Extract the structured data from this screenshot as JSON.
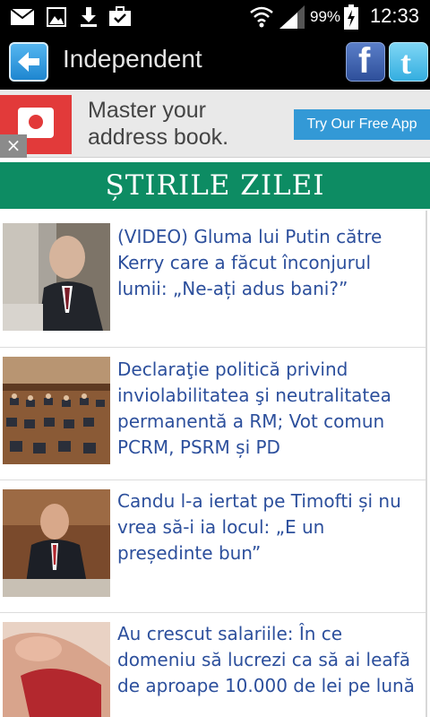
{
  "status_bar": {
    "battery": "99%",
    "time": "12:33",
    "icons": [
      "mail-icon",
      "image-icon",
      "download-icon",
      "briefcase-icon",
      "wifi-icon",
      "signal-icon",
      "battery-icon"
    ]
  },
  "app_bar": {
    "title": "Independent",
    "back_icon": "back-arrow-icon",
    "facebook_label": "f",
    "twitter_label": "t"
  },
  "ad": {
    "headline": "Master your address book.",
    "cta": "Try Our Free App",
    "close": "×",
    "brand_color": "#e23a3a",
    "cta_color": "#3399d6"
  },
  "section": {
    "title": "ȘTIRILE ZILEI",
    "color": "#0d8c63"
  },
  "news": [
    {
      "title": "(VIDEO) Gluma lui Putin către Kerry care a făcut înconjurul lumii: „Ne-ați adus bani?”"
    },
    {
      "title": "Declaraţie politică privind inviolabilitatea şi neutralitatea permanentă a RM; Vot comun PCRM, PSRM și PD"
    },
    {
      "title": "Candu l-a iertat pe Timofti și nu vrea să-i ia locul: „E un președinte bun”"
    },
    {
      "title": "Au crescut salariile: În ce domeniu să lucrezi ca să ai leafă de aproape 10.000 de lei pe lună"
    }
  ],
  "link_color": "#2c4f9c"
}
